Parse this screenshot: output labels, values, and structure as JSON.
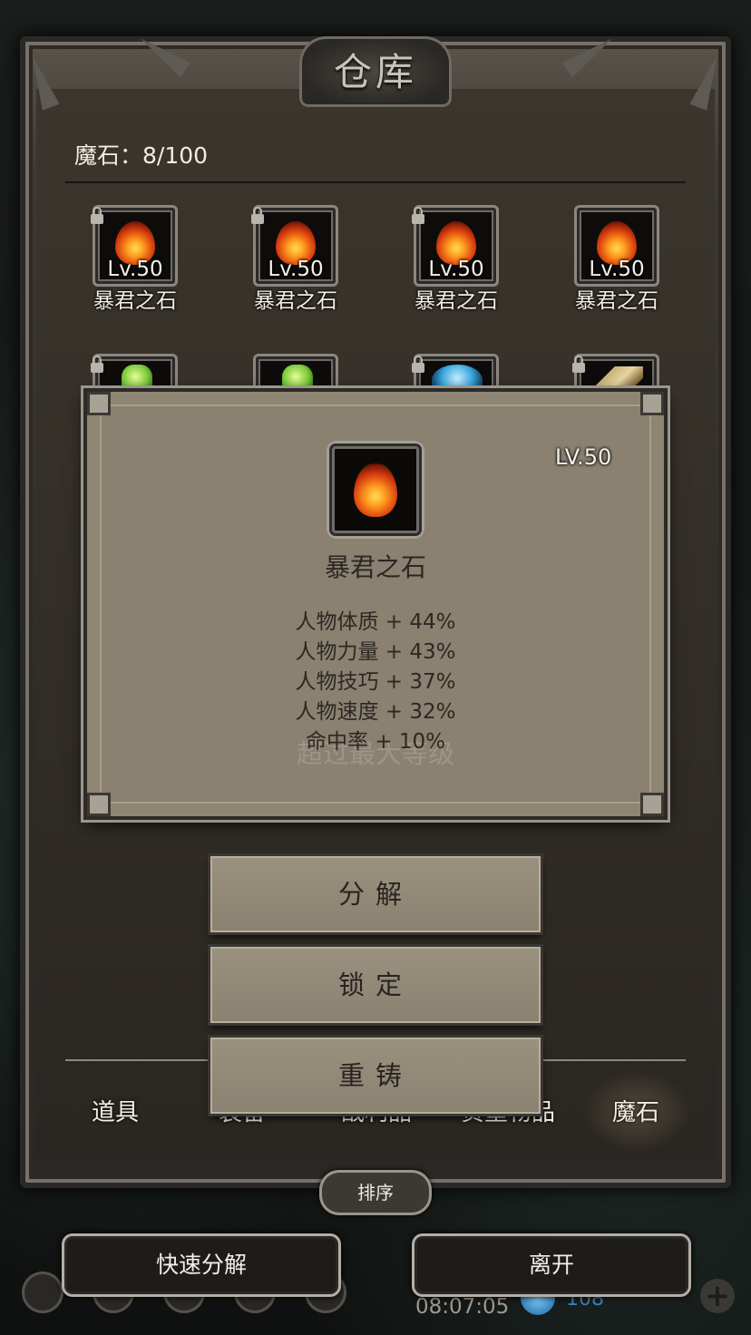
{
  "window": {
    "title": "仓库"
  },
  "inventory": {
    "count_label": "魔石：8/100",
    "row1": [
      {
        "level": "Lv.50",
        "name": "暴君之石",
        "icon": "fire-stone-icon"
      },
      {
        "level": "Lv.50",
        "name": "暴君之石",
        "icon": "fire-stone-icon"
      },
      {
        "level": "Lv.50",
        "name": "暴君之石",
        "icon": "fire-stone-icon"
      },
      {
        "level": "Lv.50",
        "name": "暴君之石",
        "icon": "fire-stone-icon"
      }
    ],
    "row2_icons": [
      "green-crystal-icon",
      "green-crystal-icon",
      "blue-orb-icon",
      "horn-relic-icon"
    ]
  },
  "tabs": [
    {
      "label": "道具"
    },
    {
      "label": "装备"
    },
    {
      "label": "战利品"
    },
    {
      "label": "贵重物品"
    },
    {
      "label": "魔石",
      "active": true
    }
  ],
  "sort_label": "排序",
  "popup": {
    "level": "LV.50",
    "name": "暴君之石",
    "stats": [
      "人物体质 + 44%",
      "人物力量 + 43%",
      "人物技巧 + 37%",
      "人物速度 + 32%",
      "命中率 + 10%"
    ],
    "overlay_text": "超过最大等级",
    "actions": {
      "decompose": "分解",
      "lock": "锁定",
      "reforge": "重铸"
    }
  },
  "bottom": {
    "quick_decompose": "快速分解",
    "leave": "离开",
    "clock": "08:07:05",
    "currency": "108"
  },
  "colors": {
    "frame": "#3c3832",
    "popup": "#8a8170",
    "flame": "#d83d0e"
  }
}
